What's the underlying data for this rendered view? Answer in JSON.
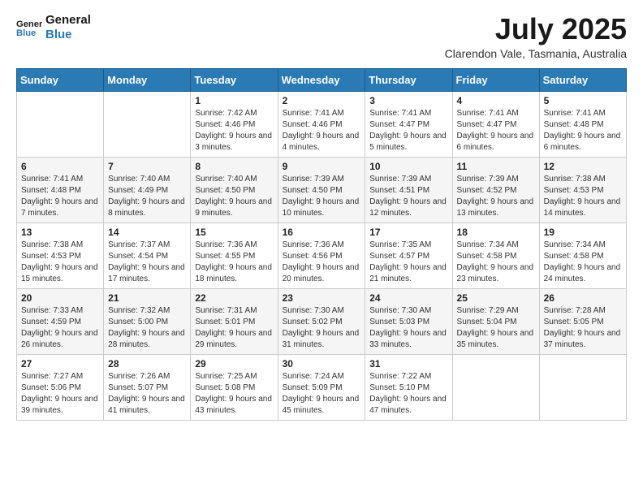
{
  "logo": {
    "line1": "General",
    "line2": "Blue"
  },
  "title": "July 2025",
  "location": "Clarendon Vale, Tasmania, Australia",
  "days_of_week": [
    "Sunday",
    "Monday",
    "Tuesday",
    "Wednesday",
    "Thursday",
    "Friday",
    "Saturday"
  ],
  "weeks": [
    [
      {
        "day": "",
        "sunrise": "",
        "sunset": "",
        "daylight": ""
      },
      {
        "day": "",
        "sunrise": "",
        "sunset": "",
        "daylight": ""
      },
      {
        "day": "1",
        "sunrise": "Sunrise: 7:42 AM",
        "sunset": "Sunset: 4:46 PM",
        "daylight": "Daylight: 9 hours and 3 minutes."
      },
      {
        "day": "2",
        "sunrise": "Sunrise: 7:41 AM",
        "sunset": "Sunset: 4:46 PM",
        "daylight": "Daylight: 9 hours and 4 minutes."
      },
      {
        "day": "3",
        "sunrise": "Sunrise: 7:41 AM",
        "sunset": "Sunset: 4:47 PM",
        "daylight": "Daylight: 9 hours and 5 minutes."
      },
      {
        "day": "4",
        "sunrise": "Sunrise: 7:41 AM",
        "sunset": "Sunset: 4:47 PM",
        "daylight": "Daylight: 9 hours and 6 minutes."
      },
      {
        "day": "5",
        "sunrise": "Sunrise: 7:41 AM",
        "sunset": "Sunset: 4:48 PM",
        "daylight": "Daylight: 9 hours and 6 minutes."
      }
    ],
    [
      {
        "day": "6",
        "sunrise": "Sunrise: 7:41 AM",
        "sunset": "Sunset: 4:48 PM",
        "daylight": "Daylight: 9 hours and 7 minutes."
      },
      {
        "day": "7",
        "sunrise": "Sunrise: 7:40 AM",
        "sunset": "Sunset: 4:49 PM",
        "daylight": "Daylight: 9 hours and 8 minutes."
      },
      {
        "day": "8",
        "sunrise": "Sunrise: 7:40 AM",
        "sunset": "Sunset: 4:50 PM",
        "daylight": "Daylight: 9 hours and 9 minutes."
      },
      {
        "day": "9",
        "sunrise": "Sunrise: 7:39 AM",
        "sunset": "Sunset: 4:50 PM",
        "daylight": "Daylight: 9 hours and 10 minutes."
      },
      {
        "day": "10",
        "sunrise": "Sunrise: 7:39 AM",
        "sunset": "Sunset: 4:51 PM",
        "daylight": "Daylight: 9 hours and 12 minutes."
      },
      {
        "day": "11",
        "sunrise": "Sunrise: 7:39 AM",
        "sunset": "Sunset: 4:52 PM",
        "daylight": "Daylight: 9 hours and 13 minutes."
      },
      {
        "day": "12",
        "sunrise": "Sunrise: 7:38 AM",
        "sunset": "Sunset: 4:53 PM",
        "daylight": "Daylight: 9 hours and 14 minutes."
      }
    ],
    [
      {
        "day": "13",
        "sunrise": "Sunrise: 7:38 AM",
        "sunset": "Sunset: 4:53 PM",
        "daylight": "Daylight: 9 hours and 15 minutes."
      },
      {
        "day": "14",
        "sunrise": "Sunrise: 7:37 AM",
        "sunset": "Sunset: 4:54 PM",
        "daylight": "Daylight: 9 hours and 17 minutes."
      },
      {
        "day": "15",
        "sunrise": "Sunrise: 7:36 AM",
        "sunset": "Sunset: 4:55 PM",
        "daylight": "Daylight: 9 hours and 18 minutes."
      },
      {
        "day": "16",
        "sunrise": "Sunrise: 7:36 AM",
        "sunset": "Sunset: 4:56 PM",
        "daylight": "Daylight: 9 hours and 20 minutes."
      },
      {
        "day": "17",
        "sunrise": "Sunrise: 7:35 AM",
        "sunset": "Sunset: 4:57 PM",
        "daylight": "Daylight: 9 hours and 21 minutes."
      },
      {
        "day": "18",
        "sunrise": "Sunrise: 7:34 AM",
        "sunset": "Sunset: 4:58 PM",
        "daylight": "Daylight: 9 hours and 23 minutes."
      },
      {
        "day": "19",
        "sunrise": "Sunrise: 7:34 AM",
        "sunset": "Sunset: 4:58 PM",
        "daylight": "Daylight: 9 hours and 24 minutes."
      }
    ],
    [
      {
        "day": "20",
        "sunrise": "Sunrise: 7:33 AM",
        "sunset": "Sunset: 4:59 PM",
        "daylight": "Daylight: 9 hours and 26 minutes."
      },
      {
        "day": "21",
        "sunrise": "Sunrise: 7:32 AM",
        "sunset": "Sunset: 5:00 PM",
        "daylight": "Daylight: 9 hours and 28 minutes."
      },
      {
        "day": "22",
        "sunrise": "Sunrise: 7:31 AM",
        "sunset": "Sunset: 5:01 PM",
        "daylight": "Daylight: 9 hours and 29 minutes."
      },
      {
        "day": "23",
        "sunrise": "Sunrise: 7:30 AM",
        "sunset": "Sunset: 5:02 PM",
        "daylight": "Daylight: 9 hours and 31 minutes."
      },
      {
        "day": "24",
        "sunrise": "Sunrise: 7:30 AM",
        "sunset": "Sunset: 5:03 PM",
        "daylight": "Daylight: 9 hours and 33 minutes."
      },
      {
        "day": "25",
        "sunrise": "Sunrise: 7:29 AM",
        "sunset": "Sunset: 5:04 PM",
        "daylight": "Daylight: 9 hours and 35 minutes."
      },
      {
        "day": "26",
        "sunrise": "Sunrise: 7:28 AM",
        "sunset": "Sunset: 5:05 PM",
        "daylight": "Daylight: 9 hours and 37 minutes."
      }
    ],
    [
      {
        "day": "27",
        "sunrise": "Sunrise: 7:27 AM",
        "sunset": "Sunset: 5:06 PM",
        "daylight": "Daylight: 9 hours and 39 minutes."
      },
      {
        "day": "28",
        "sunrise": "Sunrise: 7:26 AM",
        "sunset": "Sunset: 5:07 PM",
        "daylight": "Daylight: 9 hours and 41 minutes."
      },
      {
        "day": "29",
        "sunrise": "Sunrise: 7:25 AM",
        "sunset": "Sunset: 5:08 PM",
        "daylight": "Daylight: 9 hours and 43 minutes."
      },
      {
        "day": "30",
        "sunrise": "Sunrise: 7:24 AM",
        "sunset": "Sunset: 5:09 PM",
        "daylight": "Daylight: 9 hours and 45 minutes."
      },
      {
        "day": "31",
        "sunrise": "Sunrise: 7:22 AM",
        "sunset": "Sunset: 5:10 PM",
        "daylight": "Daylight: 9 hours and 47 minutes."
      },
      {
        "day": "",
        "sunrise": "",
        "sunset": "",
        "daylight": ""
      },
      {
        "day": "",
        "sunrise": "",
        "sunset": "",
        "daylight": ""
      }
    ]
  ]
}
